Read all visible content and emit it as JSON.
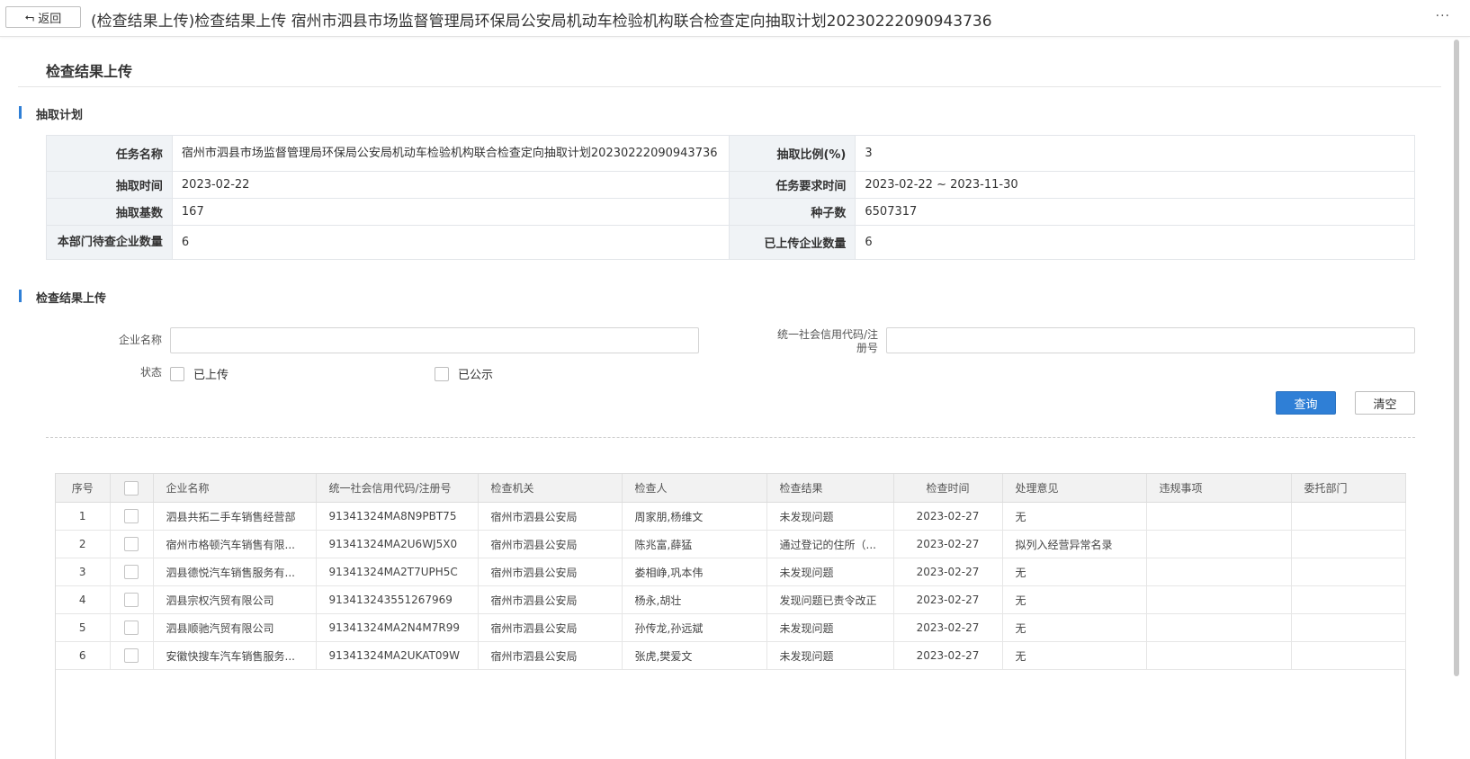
{
  "topbar": {
    "back_label": "返回",
    "title": "(检查结果上传)检查结果上传 宿州市泗县市场监督管理局环保局公安局机动车检验机构联合检查定向抽取计划20230222090943736",
    "more": "···"
  },
  "page_title": "检查结果上传",
  "plan_section": {
    "heading": "抽取计划",
    "rows": [
      {
        "l1": "任务名称",
        "v1": "宿州市泗县市场监督管理局环保局公安局机动车检验机构联合检查定向抽取计划20230222090943736",
        "l2": "抽取比例(%)",
        "v2": "3"
      },
      {
        "l1": "抽取时间",
        "v1": "2023-02-22",
        "l2": "任务要求时间",
        "v2": "2023-02-22 ~ 2023-11-30"
      },
      {
        "l1": "抽取基数",
        "v1": "167",
        "l2": "种子数",
        "v2": "6507317"
      },
      {
        "l1": "本部门待查企业数量",
        "v1": "6",
        "l2": "已上传企业数量",
        "v2": "6"
      }
    ]
  },
  "upload_section": {
    "heading": "检查结果上传",
    "company_label": "企业名称",
    "company_value": "",
    "credit_label": "统一社会信用代码/注册号",
    "credit_value": "",
    "status_label": "状态",
    "opt_uploaded": "已上传",
    "opt_published": "已公示",
    "query_button": "查询",
    "clear_button": "清空"
  },
  "grid": {
    "columns": [
      "序号",
      "",
      "企业名称",
      "统一社会信用代码/注册号",
      "检查机关",
      "检查人",
      "检查结果",
      "检查时间",
      "处理意见",
      "违规事项",
      "委托部门"
    ],
    "rows": [
      [
        "1",
        "",
        "泗县共拓二手车销售经营部",
        "91341324MA8N9PBT75",
        "宿州市泗县公安局",
        "周家朋,杨维文",
        "未发现问题",
        "2023-02-27",
        "无",
        "",
        ""
      ],
      [
        "2",
        "",
        "宿州市格顿汽车销售有限...",
        "91341324MA2U6WJ5X0",
        "宿州市泗县公安局",
        "陈兆富,薛猛",
        "通过登记的住所（...",
        "2023-02-27",
        "拟列入经营异常名录",
        "",
        ""
      ],
      [
        "3",
        "",
        "泗县德悦汽车销售服务有...",
        "91341324MA2T7UPH5C",
        "宿州市泗县公安局",
        "娄相峥,巩本伟",
        "未发现问题",
        "2023-02-27",
        "无",
        "",
        ""
      ],
      [
        "4",
        "",
        "泗县宗权汽贸有限公司",
        "913413243551267969",
        "宿州市泗县公安局",
        "杨永,胡壮",
        "发现问题已责令改正",
        "2023-02-27",
        "无",
        "",
        ""
      ],
      [
        "5",
        "",
        "泗县顺驰汽贸有限公司",
        "91341324MA2N4M7R99",
        "宿州市泗县公安局",
        "孙传龙,孙远斌",
        "未发现问题",
        "2023-02-27",
        "无",
        "",
        ""
      ],
      [
        "6",
        "",
        "安徽快搜车汽车销售服务...",
        "91341324MA2UKAT09W",
        "宿州市泗县公安局",
        "张虎,樊爱文",
        "未发现问题",
        "2023-02-27",
        "无",
        "",
        ""
      ]
    ]
  }
}
